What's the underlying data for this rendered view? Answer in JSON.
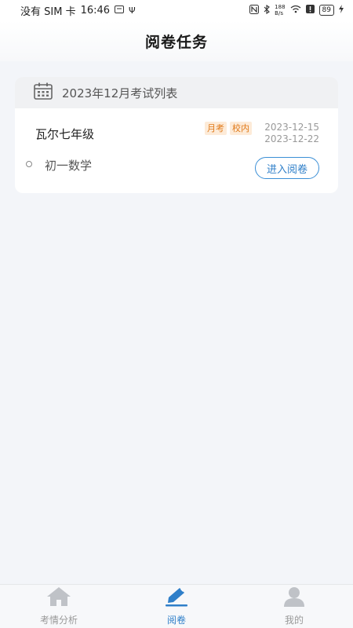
{
  "status_bar": {
    "carrier": "没有 SIM 卡",
    "time": "16:46",
    "speed_value": "188",
    "speed_unit": "B/s",
    "battery": "89"
  },
  "header": {
    "title": "阅卷任务"
  },
  "exam_list": {
    "heading": "2023年12月考试列表",
    "items": [
      {
        "school": "瓦尔七年级",
        "tags": [
          "月考",
          "校内"
        ],
        "start_date": "2023-12-15",
        "end_date": "2023-12-22",
        "subject": "初一数学",
        "action_label": "进入阅卷"
      }
    ]
  },
  "tabbar": {
    "tabs": [
      {
        "label": "考情分析",
        "icon": "home-icon",
        "active": false
      },
      {
        "label": "阅卷",
        "icon": "pen-icon",
        "active": true
      },
      {
        "label": "我的",
        "icon": "user-icon",
        "active": false
      }
    ],
    "active_color": "#2f7fc9",
    "inactive_color": "#bfc2c7"
  }
}
